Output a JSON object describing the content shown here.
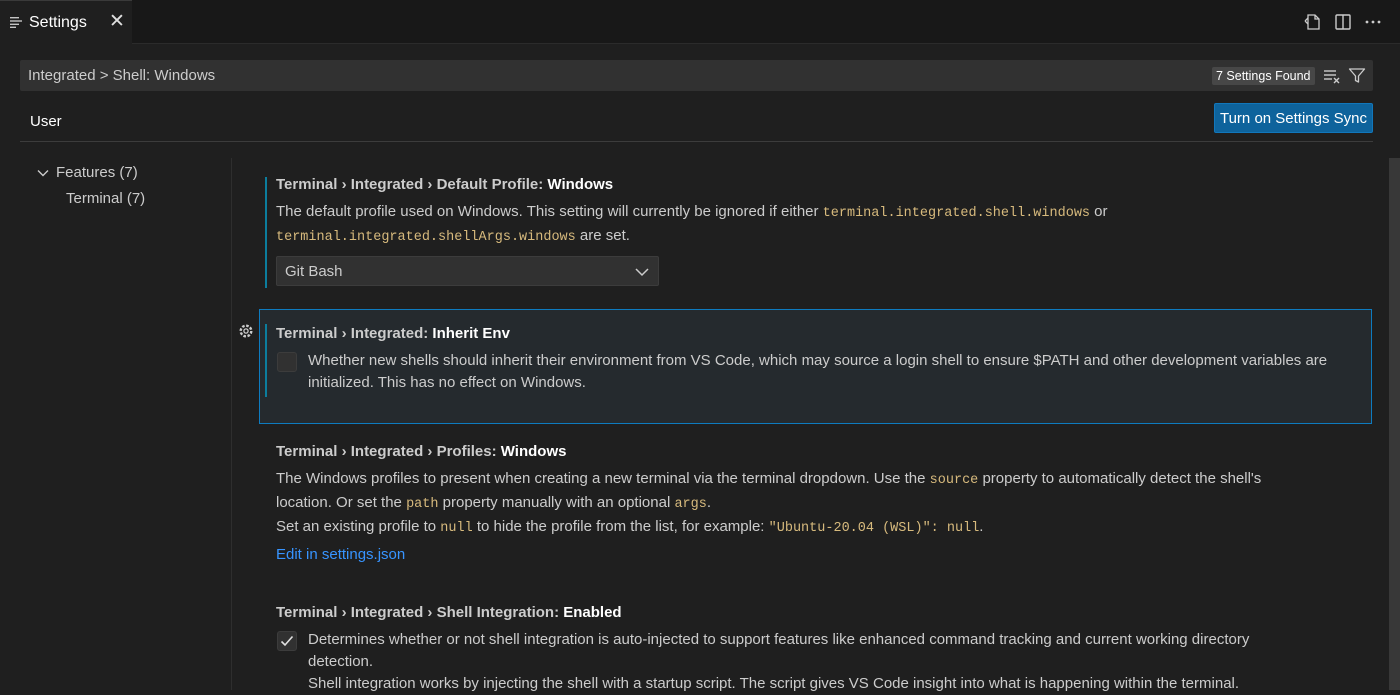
{
  "tab": {
    "label": "Settings",
    "close": "✕"
  },
  "search": {
    "query": "Integrated > Shell: Windows",
    "results_badge": "7 Settings Found"
  },
  "scope": {
    "user_tab": "User",
    "sync_button": "Turn on Settings Sync"
  },
  "toc": {
    "features": "Features (7)",
    "terminal": "Terminal (7)"
  },
  "settings": [
    {
      "category": "Terminal › Integrated › Default Profile: ",
      "key": "Windows",
      "desc_1": "The default profile used on Windows. This setting will currently be ignored if either ",
      "code_1": "terminal.integrated.shell.windows",
      "desc_2": " or",
      "code_2": "terminal.integrated.shellArgs.windows",
      "desc_3": " are set.",
      "select_value": "Git Bash"
    },
    {
      "category": "Terminal › Integrated: ",
      "key": "Inherit Env",
      "desc": "Whether new shells should inherit their environment from VS Code, which may source a login shell to ensure $PATH and other development variables are initialized. This has no effect on Windows.",
      "checked": false
    },
    {
      "category": "Terminal › Integrated › Profiles: ",
      "key": "Windows",
      "desc_1": "The Windows profiles to present when creating a new terminal via the terminal dropdown. Use the ",
      "code_1": "source",
      "desc_2": " property to automatically detect the shell's",
      "desc_3": "location. Or set the ",
      "code_2": "path",
      "desc_4": " property manually with an optional ",
      "code_3": "args",
      "desc_5": ".",
      "desc_6": "Set an existing profile to ",
      "code_4": "null",
      "desc_7": " to hide the profile from the list, for example: ",
      "code_5": "\"Ubuntu-20.04 (WSL)\": null",
      "desc_8": ".",
      "link": "Edit in settings.json"
    },
    {
      "category": "Terminal › Integrated › Shell Integration: ",
      "key": "Enabled",
      "desc_1": "Determines whether or not shell integration is auto-injected to support features like enhanced command tracking and current working directory",
      "desc_2": "detection.",
      "desc_3": "Shell integration works by injecting the shell with a startup script. The script gives VS Code insight into what is happening within the terminal.",
      "checked": true
    }
  ],
  "colors": {
    "accent": "#0e639c",
    "focus_border": "#0e7bbf",
    "link": "#3794ff",
    "code": "#d7ba7d",
    "modified": "#0c7d9d"
  },
  "icons": [
    "settings-editor-icon",
    "close-icon",
    "open-json-icon",
    "split-editor-icon",
    "more-actions-icon",
    "clear-filter-icon",
    "filter-icon",
    "chevron-down-icon",
    "gear-icon",
    "checkmark-icon"
  ]
}
